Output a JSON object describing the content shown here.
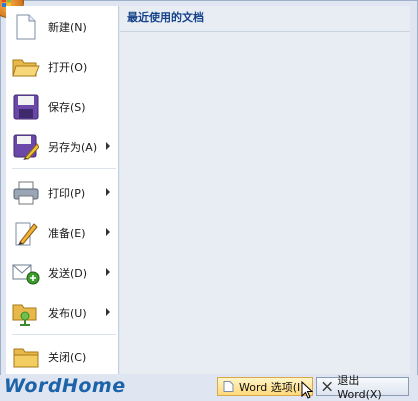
{
  "menu": {
    "items": [
      {
        "label": "新建(N)",
        "icon": "new-document-icon"
      },
      {
        "label": "打开(O)",
        "icon": "open-folder-icon"
      },
      {
        "label": "保存(S)",
        "icon": "save-disk-icon"
      },
      {
        "label": "另存为(A)",
        "icon": "save-as-icon"
      },
      {
        "label": "打印(P)",
        "icon": "printer-icon"
      },
      {
        "label": "准备(E)",
        "icon": "prepare-icon"
      },
      {
        "label": "发送(D)",
        "icon": "send-icon"
      },
      {
        "label": "发布(U)",
        "icon": "publish-icon"
      },
      {
        "label": "关闭(C)",
        "icon": "close-folder-icon"
      }
    ]
  },
  "recent": {
    "header": "最近使用的文档"
  },
  "watermark": "WordHome",
  "footer": {
    "options_label": "Word 选项(I)",
    "exit_label": "退出 Word(X)"
  }
}
